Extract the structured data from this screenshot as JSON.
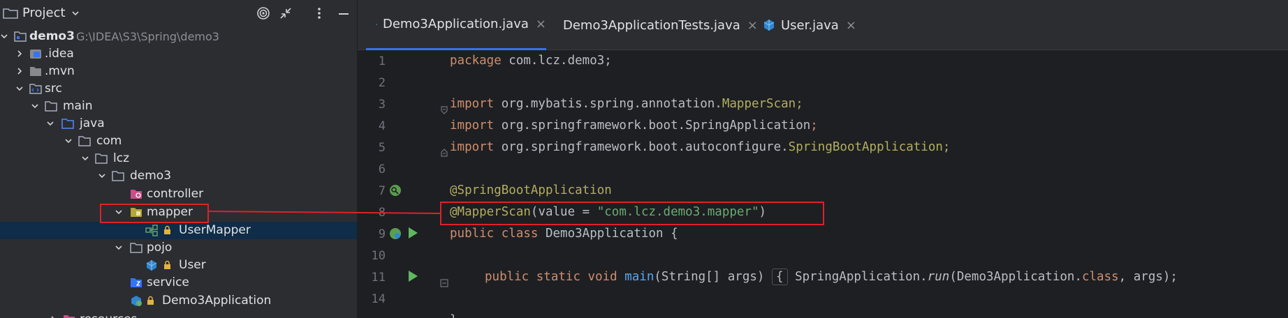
{
  "project_panel": {
    "title": "Project",
    "tree": [
      {
        "label": "demo3",
        "path": "G:\\IDEA\\S3\\Spring\\demo3"
      },
      {
        "label": ".idea"
      },
      {
        "label": ".mvn"
      },
      {
        "label": "src"
      },
      {
        "label": "main"
      },
      {
        "label": "java"
      },
      {
        "label": "com"
      },
      {
        "label": "lcz"
      },
      {
        "label": "demo3"
      },
      {
        "label": "controller"
      },
      {
        "label": "mapper"
      },
      {
        "label": "UserMapper"
      },
      {
        "label": "pojo"
      },
      {
        "label": "User"
      },
      {
        "label": "service"
      },
      {
        "label": "Demo3Application"
      },
      {
        "label": "resources"
      }
    ]
  },
  "editor": {
    "tabs": [
      {
        "label": "Demo3Application.java",
        "close": "×"
      },
      {
        "label": "Demo3ApplicationTests.java",
        "close": "×"
      },
      {
        "label": "User.java",
        "close": "×"
      }
    ],
    "line_numbers": [
      "1",
      "2",
      "3",
      "4",
      "5",
      "6",
      "7",
      "8",
      "9",
      "10",
      "11",
      "14"
    ],
    "code": {
      "l1": {
        "kw": "package",
        "rest": " com.lcz.demo3;"
      },
      "l3": {
        "kw": "import",
        "pkg": " org.mybatis.spring.annotation.",
        "cls": "MapperScan",
        "semi": ";"
      },
      "l4": {
        "kw": "import",
        "pkg": " org.springframework.boot.SpringApplication",
        "semi": ";"
      },
      "l5": {
        "kw": "import",
        "pkg": " org.springframework.boot.autoconfigure.",
        "cls": "SpringBootApplication",
        "semi": ";"
      },
      "l7": {
        "ann": "@SpringBootApplication"
      },
      "l8": {
        "ann": "@MapperScan",
        "open": "(value = ",
        "str": "\"com.lcz.demo3.mapper\"",
        "close": ")"
      },
      "l9": {
        "kw1": "public",
        "kw2": "class",
        "name": " Demo3Application {"
      },
      "l11": {
        "kw1": "public",
        "kw2": "static",
        "kw3": "void",
        "fn": "main",
        "params": "(String[] args)",
        "brace": "{",
        "call_cls": " SpringApplication.",
        "call_fn": "run",
        "args1": "(Demo3Application.",
        "kwc": "class",
        "args2": ", args);"
      },
      "l14": {
        "text": "}"
      }
    }
  },
  "colors": {
    "highlight_box": "#e0202a",
    "active_tab_accent": "#3574f0",
    "selection": "#0f2c48"
  }
}
